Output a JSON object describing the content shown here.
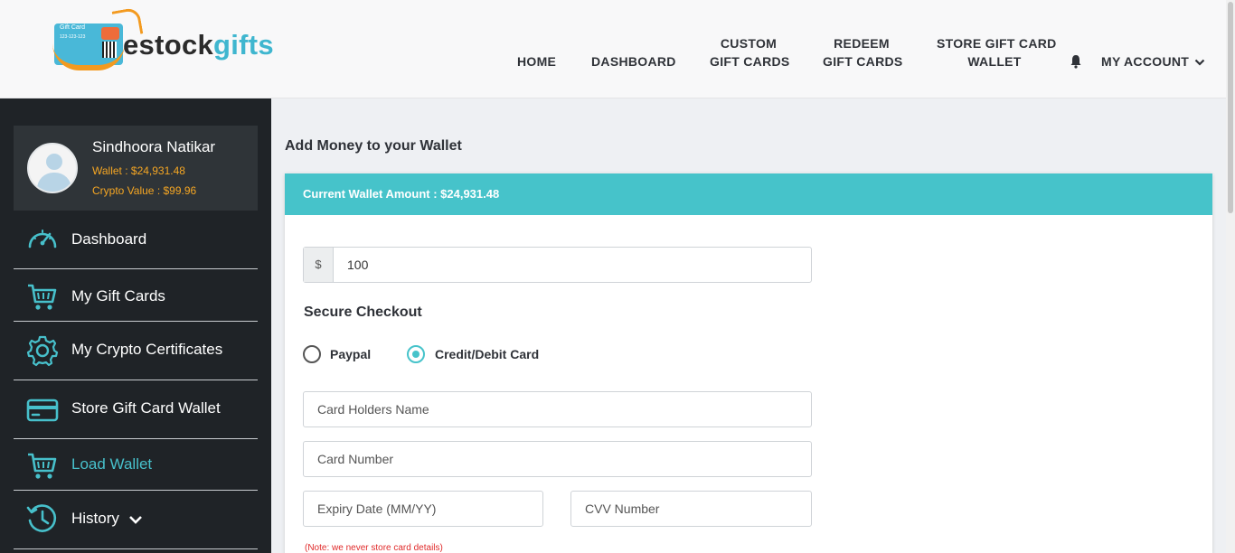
{
  "brand": {
    "name_part1": "estock",
    "name_part2": "gifts",
    "card_text": "Gift Card",
    "card_number": "123-123-123"
  },
  "nav": {
    "home": "HOME",
    "dashboard": "DASHBOARD",
    "custom_line1": "CUSTOM",
    "custom_line2": "GIFT CARDS",
    "redeem_line1": "REDEEM",
    "redeem_line2": "GIFT CARDS",
    "store_line1": "STORE GIFT CARD",
    "store_line2": "WALLET",
    "account": "MY ACCOUNT"
  },
  "profile": {
    "name": "Sindhoora Natikar",
    "wallet": "Wallet : $24,931.48",
    "crypto": "Crypto Value : $99.96"
  },
  "sidebar": {
    "items": [
      {
        "label": "Dashboard",
        "icon": "speedometer-icon"
      },
      {
        "label": "My Gift Cards",
        "icon": "cart-icon"
      },
      {
        "label": "My Crypto Certificates",
        "icon": "gear-icon"
      },
      {
        "label": "Store Gift Card Wallet",
        "icon": "card-icon"
      },
      {
        "label": "Load Wallet",
        "icon": "cart-icon",
        "active": true
      },
      {
        "label": "History",
        "icon": "history-icon"
      }
    ]
  },
  "main": {
    "title": "Add Money to your Wallet",
    "current_wallet": "Current Wallet Amount : $24,931.48",
    "currency_symbol": "$",
    "amount": "100",
    "secure_checkout": "Secure Checkout",
    "payment_options": [
      "Paypal",
      "Credit/Debit Card"
    ],
    "selected_payment": "Credit/Debit Card",
    "card_holder_placeholder": "Card Holders Name",
    "card_number_placeholder": "Card Number",
    "expiry_placeholder": "Expiry Date (MM/YY)",
    "cvv_placeholder": "CVV Number",
    "note": "(Note: we never store card details)"
  },
  "colors": {
    "accent": "#46c3ca",
    "sidebar_bg": "#1f2327",
    "wallet_text": "#f5a623",
    "note_text": "#e02a2a"
  }
}
